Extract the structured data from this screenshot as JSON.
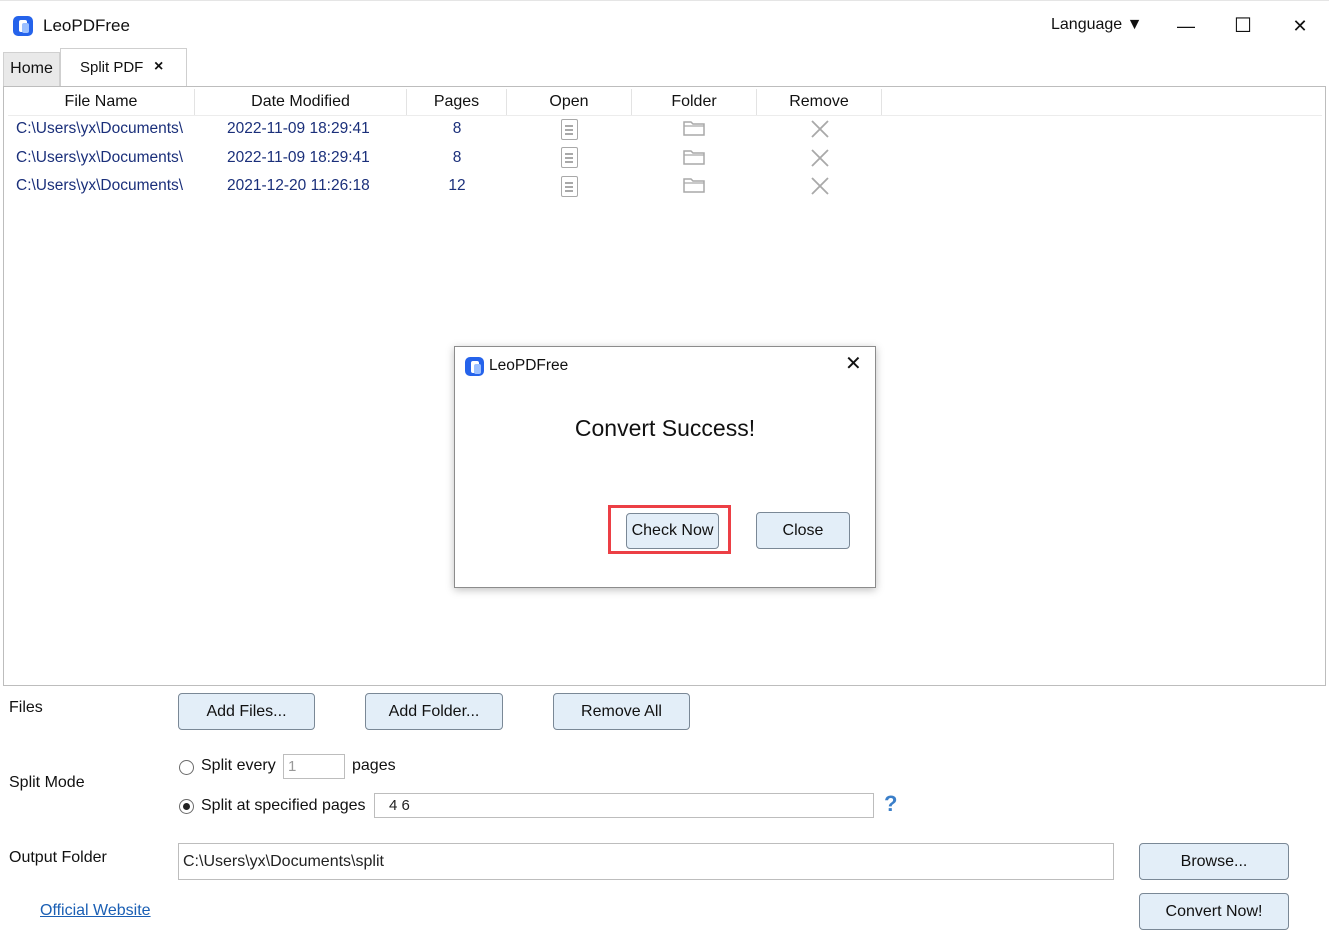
{
  "app": {
    "title": "LeoPDFree",
    "language_label": "Language ▼"
  },
  "window_controls": {
    "minimize": "—",
    "maximize": "☐",
    "close": "✕"
  },
  "tabs": [
    {
      "label": "Home",
      "active": false
    },
    {
      "label": "Split PDF",
      "active": true,
      "close": "×"
    }
  ],
  "table": {
    "columns": [
      "File Name",
      "Date Modified",
      "Pages",
      "Open",
      "Folder",
      "Remove"
    ],
    "rows": [
      {
        "file_name": "C:\\Users\\yx\\Documents\\",
        "date_modified": "2022-11-09 18:29:41",
        "pages": "8"
      },
      {
        "file_name": "C:\\Users\\yx\\Documents\\",
        "date_modified": "2022-11-09 18:29:41",
        "pages": "8"
      },
      {
        "file_name": "C:\\Users\\yx\\Documents\\",
        "date_modified": "2021-12-20 11:26:18",
        "pages": "12"
      }
    ]
  },
  "dialog": {
    "title": "LeoPDFree",
    "close": "✕",
    "message": "Convert Success!",
    "check_now_label": "Check Now",
    "close_label": "Close",
    "highlight_color": "#ec3f45"
  },
  "files": {
    "label": "Files",
    "add_files": "Add Files...",
    "add_folder": "Add Folder...",
    "remove_all": "Remove All"
  },
  "split_mode": {
    "label": "Split Mode",
    "every_label": "Split every",
    "every_value": "1",
    "every_suffix": "pages",
    "specified_label": "Split at specified pages",
    "specified_value": "4 6",
    "selected": "specified",
    "help": "?"
  },
  "output": {
    "label": "Output Folder",
    "path": "C:\\Users\\yx\\Documents\\split",
    "browse": "Browse..."
  },
  "footer": {
    "website_link": "Official Website",
    "convert_now": "Convert Now!"
  },
  "colors": {
    "accent": "#2563eb",
    "button_bg": "#e3eef8",
    "link": "#1a5fb4",
    "file_text": "#1a2f7a"
  }
}
